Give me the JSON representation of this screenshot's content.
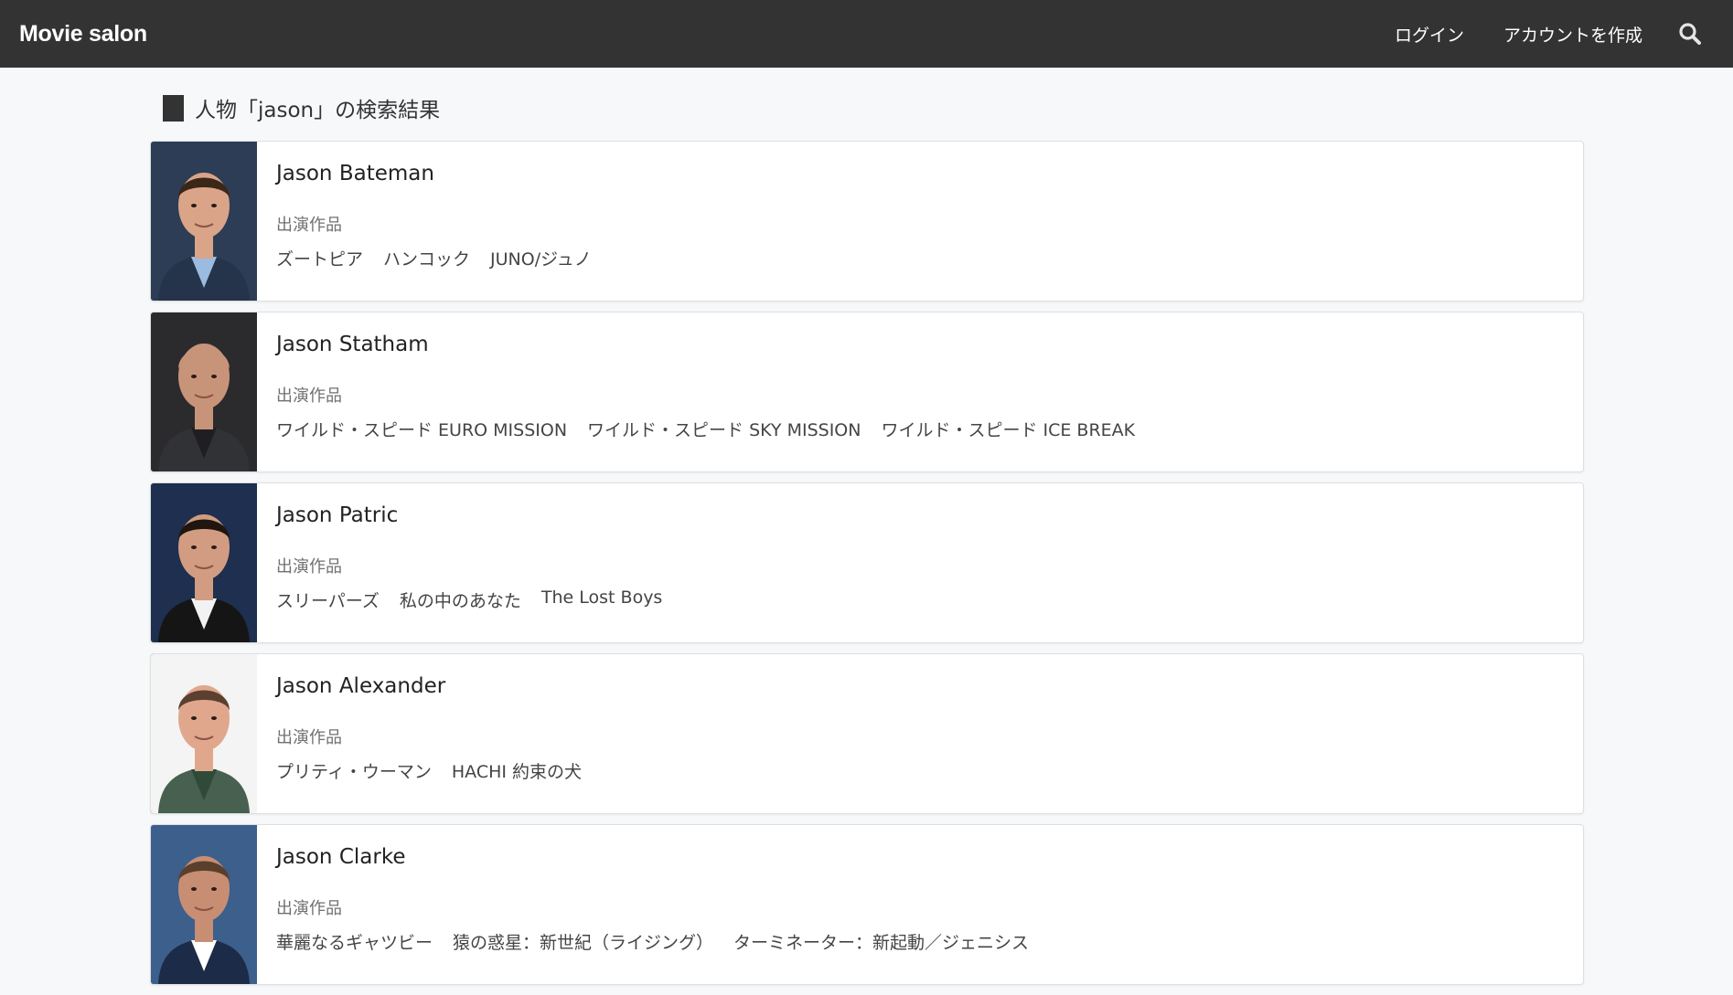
{
  "header": {
    "brand": "Movie salon",
    "login": "ログイン",
    "signup": "アカウントを作成",
    "search_icon": "search-icon"
  },
  "main": {
    "heading": "人物「jason」の検索結果"
  },
  "results": [
    {
      "name": "Jason Bateman",
      "works_label": "出演作品",
      "works": [
        "ズートピア",
        "ハンコック",
        "JUNO/ジュノ"
      ],
      "photo": {
        "bg": "#2c3d55",
        "skin": "#d9a488",
        "hair": "#3a2718",
        "shirt": "#9bbbe0",
        "jacket": "#25344a"
      }
    },
    {
      "name": "Jason Statham",
      "works_label": "出演作品",
      "works": [
        "ワイルド・スピード EURO MISSION",
        "ワイルド・スピード SKY MISSION",
        "ワイルド・スピード ICE BREAK"
      ],
      "photo": {
        "bg": "#2b2b2e",
        "skin": "#c89479",
        "hair": "#c89479",
        "shirt": "#1f1f22",
        "jacket": "#303236"
      }
    },
    {
      "name": "Jason Patric",
      "works_label": "出演作品",
      "works": [
        "スリーパーズ",
        "私の中のあなた",
        "The Lost Boys"
      ],
      "photo": {
        "bg": "#1e2f4f",
        "skin": "#d19c82",
        "hair": "#20160f",
        "shirt": "#f2f2f2",
        "jacket": "#151515"
      }
    },
    {
      "name": "Jason Alexander",
      "works_label": "出演作品",
      "works": [
        "プリティ・ウーマン",
        "HACHI 約束の犬"
      ],
      "photo": {
        "bg": "#f4f4f4",
        "skin": "#e0a78d",
        "hair": "#5b4030",
        "shirt": "#2f4a38",
        "jacket": "#48604f"
      }
    },
    {
      "name": "Jason Clarke",
      "works_label": "出演作品",
      "works": [
        "華麗なるギャツビー",
        "猿の惑星：新世紀（ライジング）",
        "ターミネーター：新起動／ジェニシス"
      ],
      "photo": {
        "bg": "#3d5f8c",
        "skin": "#c78e73",
        "hair": "#5a3f2c",
        "shirt": "#ffffff",
        "jacket": "#1c2b47"
      }
    }
  ],
  "colors": {
    "topbar": "#333333",
    "page_bg": "#f7f8f9",
    "card_bg": "#ffffff"
  }
}
